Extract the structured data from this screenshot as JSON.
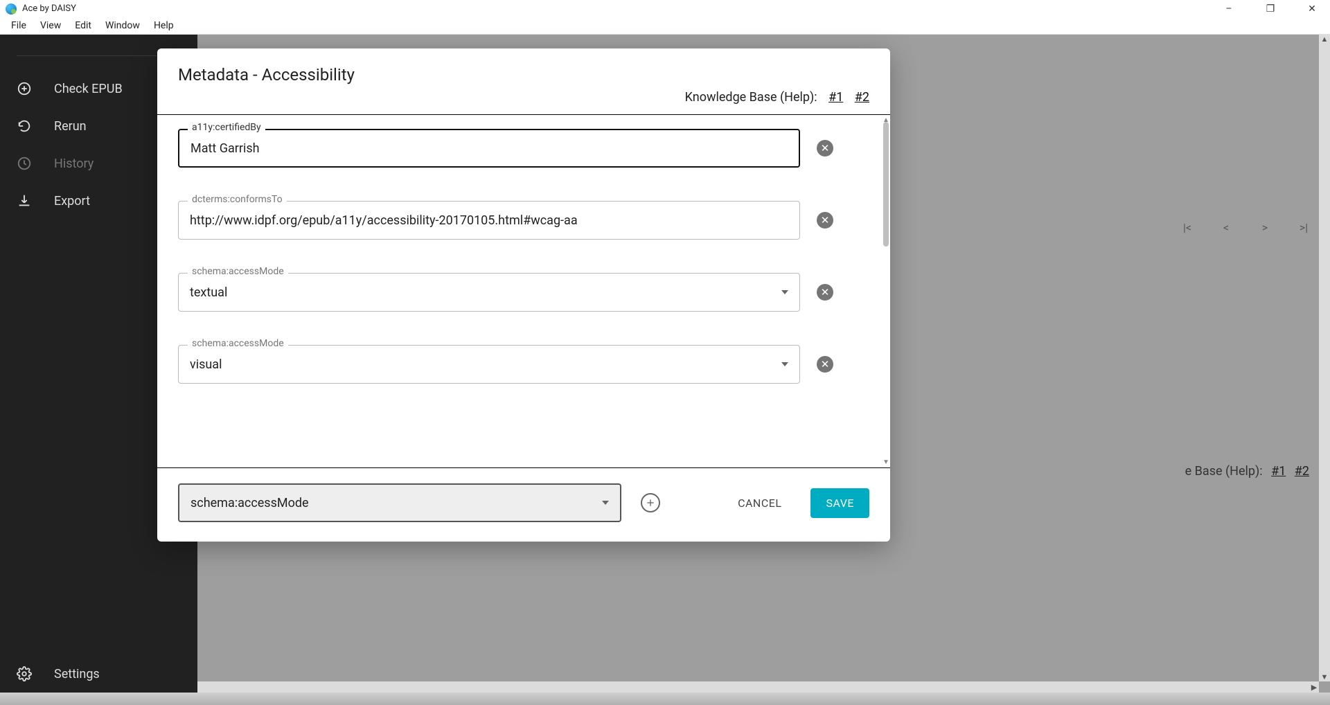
{
  "window": {
    "title": "Ace by DAISY"
  },
  "menu": {
    "items": [
      "File",
      "View",
      "Edit",
      "Window",
      "Help"
    ]
  },
  "sidebar": {
    "items": [
      {
        "label": "Check EPUB"
      },
      {
        "label": "Rerun"
      },
      {
        "label": "History"
      },
      {
        "label": "Export"
      }
    ],
    "settings": "Settings"
  },
  "background": {
    "kb_label": "e Base (Help):",
    "kb_links": [
      "#1",
      "#2"
    ]
  },
  "modal": {
    "title": "Metadata - Accessibility",
    "kb_label": "Knowledge Base (Help):",
    "kb_links": [
      "#1",
      "#2"
    ],
    "fields": [
      {
        "label": "a11y:certifiedBy",
        "value": "Matt Garrish",
        "type": "text",
        "focused": true
      },
      {
        "label": "dcterms:conformsTo",
        "value": "http://www.idpf.org/epub/a11y/accessibility-20170105.html#wcag-aa",
        "type": "text",
        "focused": false
      },
      {
        "label": "schema:accessMode",
        "value": "textual",
        "type": "select",
        "focused": false
      },
      {
        "label": "schema:accessMode",
        "value": "visual",
        "type": "select",
        "focused": false
      }
    ],
    "footer": {
      "add_select_value": "schema:accessMode",
      "cancel": "CANCEL",
      "save": "SAVE"
    }
  }
}
